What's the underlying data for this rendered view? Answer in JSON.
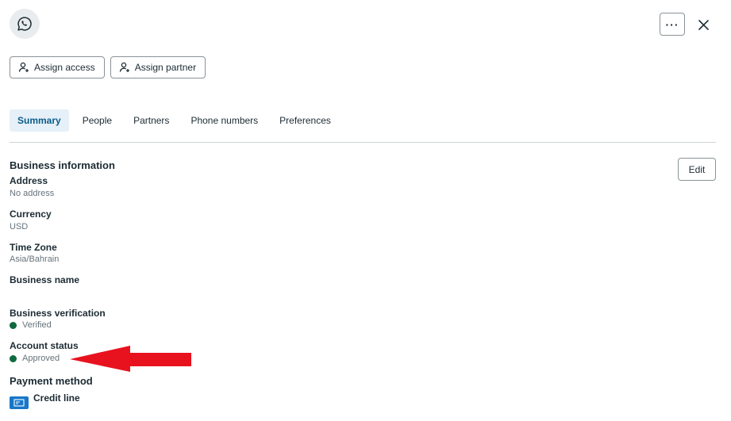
{
  "header": {
    "app_icon": "whatsapp-icon",
    "more_label": "···",
    "close_icon": "close-icon"
  },
  "actions": {
    "assign_access": "Assign access",
    "assign_partner": "Assign partner"
  },
  "tabs": [
    {
      "label": "Summary",
      "active": true
    },
    {
      "label": "People",
      "active": false
    },
    {
      "label": "Partners",
      "active": false
    },
    {
      "label": "Phone numbers",
      "active": false
    },
    {
      "label": "Preferences",
      "active": false
    }
  ],
  "business_info": {
    "title": "Business information",
    "edit_label": "Edit",
    "address_label": "Address",
    "address_value": "No address",
    "currency_label": "Currency",
    "currency_value": "USD",
    "timezone_label": "Time Zone",
    "timezone_value": "Asia/Bahrain",
    "business_name_label": "Business name",
    "verification_label": "Business verification",
    "verification_value": "Verified",
    "account_status_label": "Account status",
    "account_status_value": "Approved"
  },
  "payment": {
    "title": "Payment method",
    "method_label": "Credit line"
  },
  "colors": {
    "status_green": "#0f6b3f",
    "tab_active_bg": "#e6f0f8",
    "tab_active_text": "#0a5d8a",
    "annotation_arrow": "#e8121e",
    "card_icon": "#1877c9"
  }
}
